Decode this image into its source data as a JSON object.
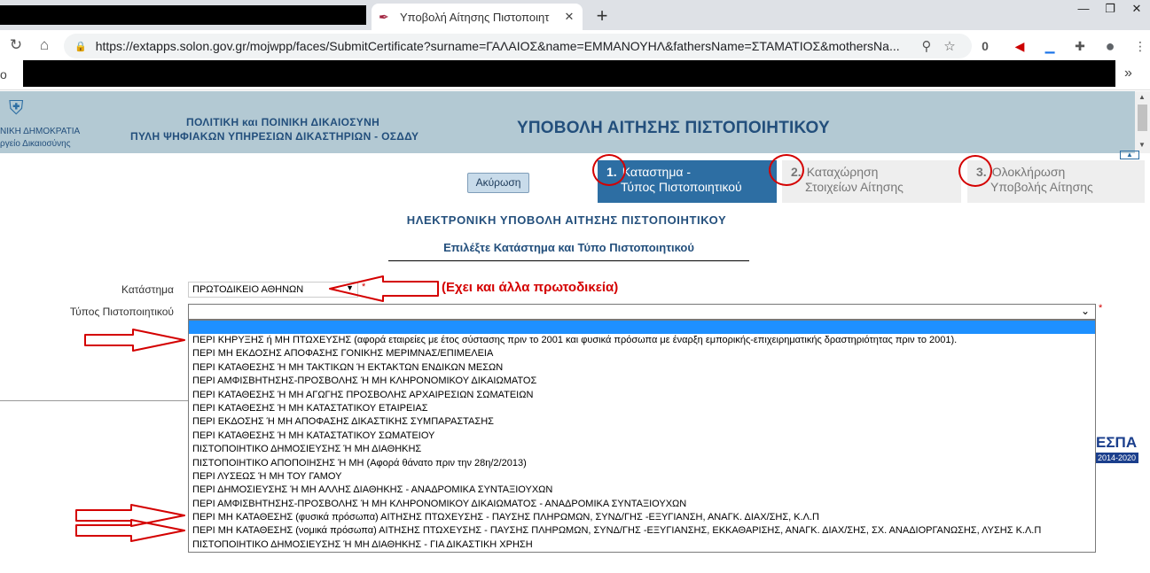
{
  "browser": {
    "tab_title": "Υποβολή Αίτησης Πιστοποιητ",
    "url": "https://extapps.solon.gov.gr/mojwpp/faces/SubmitCertificate?surname=ΓΑΛΑΙΟΣ&name=ΕΜΜΑΝΟΥΗΛ&fathersName=ΣΤΑΜΑΤΙΟΣ&mothersNa...",
    "ext_badge": "0",
    "bookmark_prefix": "ο"
  },
  "header": {
    "gov_line1": "ΝΙΚΗ ΔΗΜΟΚΡΑΤΙΑ",
    "gov_line2": "ργείο Δικαιοσύνης",
    "line1": "ΠΟΛΙΤΙΚΗ και ΠΟΙΝΙΚΗ ΔΙΚΑΙΟΣΥΝΗ",
    "line2": "ΠΥΛΗ ΨΗΦΙΑΚΩΝ ΥΠΗΡΕΣΙΩΝ ΔΙΚΑΣΤΗΡΙΩΝ - ΟΣΔΔΥ",
    "title": "ΥΠΟΒΟΛΗ ΑΙΤΗΣΗΣ ΠΙΣΤΟΠΟΙΗΤΙΚΟΥ"
  },
  "wizard": {
    "cancel_label": "Ακύρωση",
    "steps": [
      {
        "num": "1.",
        "line1": "Καταστημα  -",
        "line2": "Τύπος Πιστοποιητικού"
      },
      {
        "num": "2.",
        "line1": "Καταχώρηση",
        "line2": "Στοιχείων Αίτησης"
      },
      {
        "num": "3.",
        "line1": "Ολοκλήρωση",
        "line2": "Υποβολής Αίτησης"
      }
    ]
  },
  "form": {
    "heading": "ΗΛΕΚΤΡΟΝΙΚΗ ΥΠΟΒΟΛΗ ΑΙΤΗΣΗΣ ΠΙΣΤΟΠΟΙΗΤΙΚΟΥ",
    "subheading": "Επιλέξτε Κατάστημα και Τύπο Πιστοποιητικού",
    "store_label": "Κατάστημα",
    "store_value": "ΠΡΩΤΟΔΙΚΕΙΟ ΑΘΗΝΩΝ",
    "type_label": "Τύπος Πιστοποιητικού",
    "type_value": "",
    "required_mark": "*",
    "annotation": "(Εχει και άλλα πρωτοδικεία)",
    "options": [
      "ΠΕΡΙ ΚΗΡΥΞΗΣ ή ΜΗ ΠΤΩΧΕΥΣΗΣ (αφορά εταιρείες με έτος σύστασης πριν το 2001 και φυσικά πρόσωπα με έναρξη εμπορικής-επιχειρηματικής δραστηριότητας πριν το 2001).",
      "ΠΕΡΙ ΜΗ ΕΚΔΟΣΗΣ ΑΠΟΦΑΣΗΣ ΓΟΝΙΚΗΣ ΜΕΡΙΜΝΑΣ/ΕΠΙΜΕΛΕΙΑ",
      "ΠΕΡΙ ΚΑΤΑΘΕΣΗΣ Ή ΜΗ ΤΑΚΤΙΚΩΝ Ή ΕΚΤΑΚΤΩΝ ΕΝΔΙΚΩΝ ΜΕΣΩΝ",
      "ΠΕΡΙ ΑΜΦΙΣΒΗΤΗΣΗΣ-ΠΡΟΣΒΟΛΗΣ Ή ΜΗ ΚΛΗΡΟΝΟΜΙΚΟΥ ΔΙΚΑΙΩΜΑΤΟΣ",
      "ΠΕΡΙ ΚΑΤΑΘΕΣΗΣ Ή ΜΗ ΑΓΩΓΗΣ ΠΡΟΣΒΟΛΗΣ ΑΡΧΑΙΡΕΣΙΩΝ ΣΩΜΑΤΕΙΩΝ",
      "ΠΕΡΙ ΚΑΤΑΘΕΣΗΣ Ή ΜΗ ΚΑΤΑΣΤΑΤΙΚΟΥ ΕΤΑΙΡΕΙΑΣ",
      "ΠΕΡΙ ΕΚΔΟΣΗΣ Ή ΜΗ ΑΠΟΦΑΣΗΣ ΔΙΚΑΣΤΙΚΗΣ ΣΥΜΠΑΡΑΣΤΑΣΗΣ",
      "ΠΕΡΙ ΚΑΤΑΘΕΣΗΣ Ή ΜΗ ΚΑΤΑΣΤΑΤΙΚΟΥ ΣΩΜΑΤΕΙΟΥ",
      "ΠΙΣΤΟΠΟΙΗΤΙΚΟ ΔΗΜΟΣΙΕΥΣΗΣ Ή ΜΗ ΔΙΑΘΗΚΗΣ",
      "ΠΙΣΤΟΠΟΙΗΤΙΚΟ ΑΠΟΠΟΙΗΣΗΣ Ή ΜΗ (Αφορά θάνατο πριν την 28η/2/2013)",
      "ΠΕΡΙ ΛΥΣΕΩΣ Ή ΜΗ ΤΟΥ ΓΑΜΟΥ",
      "ΠΕΡΙ ΔΗΜΟΣΙΕΥΣΗΣ Ή ΜΗ ΑΛΛΗΣ ΔΙΑΘΗΚΗΣ - ΑΝΑΔΡΟΜΙΚΑ ΣΥΝΤΑΞΙΟΥΧΩΝ",
      "ΠΕΡΙ ΑΜΦΙΣΒΗΤΗΣΗΣ-ΠΡΟΣΒΟΛΗΣ Ή ΜΗ ΚΛΗΡΟΝΟΜΙΚΟΥ ΔΙΚΑΙΩΜΑΤΟΣ - ΑΝΑΔΡΟΜΙΚΑ ΣΥΝΤΑΞΙΟΥΧΩΝ",
      "ΠΕΡΙ ΜΗ ΚΑΤΑΘΕΣΗΣ (φυσικά πρόσωπα) ΑΙΤΗΣΗΣ ΠΤΩΧΕΥΣΗΣ - ΠΑΥΣΗΣ ΠΛΗΡΩΜΩΝ, ΣΥΝΔ/ΓΗΣ -ΕΞΥΓΙΑΝΣΗ, ΑΝΑΓΚ. ΔΙΑΧ/ΣΗΣ, Κ.Λ.Π",
      "ΠΕΡΙ ΜΗ ΚΑΤΑΘΕΣΗΣ (νομικά πρόσωπα) ΑΙΤΗΣΗΣ ΠΤΩΧΕΥΣΗΣ - ΠΑΥΣΗΣ ΠΛΗΡΩΜΩΝ, ΣΥΝΔ/ΓΗΣ -ΕΞΥΓΙΑΝΣΗΣ, ΕΚΚΑΘΑΡΙΣΗΣ, ΑΝΑΓΚ. ΔΙΑΧ/ΣΗΣ, ΣΧ. ΑΝΑΔΙΟΡΓΑΝΩΣΗΣ, ΛΥΣΗΣ Κ.Λ.Π",
      "ΠΙΣΤΟΠΟΙΗΤΙΚΟ ΔΗΜΟΣΙΕΥΣΗΣ Ή ΜΗ ΔΙΑΘΗΚΗΣ - ΓΙΑ ΔΙΚΑΣΤΙΚΗ ΧΡΗΣΗ"
    ]
  },
  "footer": {
    "espa_label": "ΕΣΠΑ",
    "espa_years": "2014-2020"
  },
  "icons": {
    "tab_favicon": "feather-icon",
    "accent_red": "#d40000",
    "brand_blue": "#2d6ea3"
  }
}
